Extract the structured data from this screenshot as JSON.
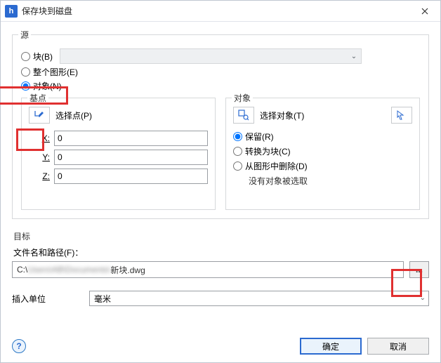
{
  "window": {
    "title": "保存块到磁盘"
  },
  "source": {
    "group_label": "源",
    "block_label": "块(B)",
    "block_key": "B",
    "whole_label": "整个图形(E)",
    "whole_key": "E",
    "objects_label": "对象(N)",
    "objects_key": "N",
    "selected": "objects"
  },
  "basepoint": {
    "group_label": "基点",
    "pick_label": "选择点(P)",
    "pick_key": "P",
    "x_label": "X:",
    "y_label": "Y:",
    "z_label": "Z:",
    "x": "0",
    "y": "0",
    "z": "0"
  },
  "objects_panel": {
    "group_label": "对象",
    "select_label": "选择对象(T)",
    "select_key": "T",
    "retain_label": "保留(R)",
    "retain_key": "R",
    "convert_label": "转换为块(C)",
    "convert_key": "C",
    "delete_label": "从图形中删除(D)",
    "delete_key": "D",
    "status": "没有对象被选取",
    "selected": "retain"
  },
  "target": {
    "group_label": "目标",
    "file_label": "文件名和路径(F)：",
    "file_key": "F",
    "file_value_prefix": "C:\\",
    "file_value_mid": "Users\\AB\\Documents\\",
    "file_value_suffix": "新块.dwg",
    "browse_label": "...",
    "unit_label": "插入单位",
    "unit_value": "毫米"
  },
  "buttons": {
    "ok": "确定",
    "cancel": "取消",
    "help_glyph": "?"
  },
  "callouts": {
    "objects_radio": true,
    "pick_icon": true,
    "browse_button": true
  }
}
